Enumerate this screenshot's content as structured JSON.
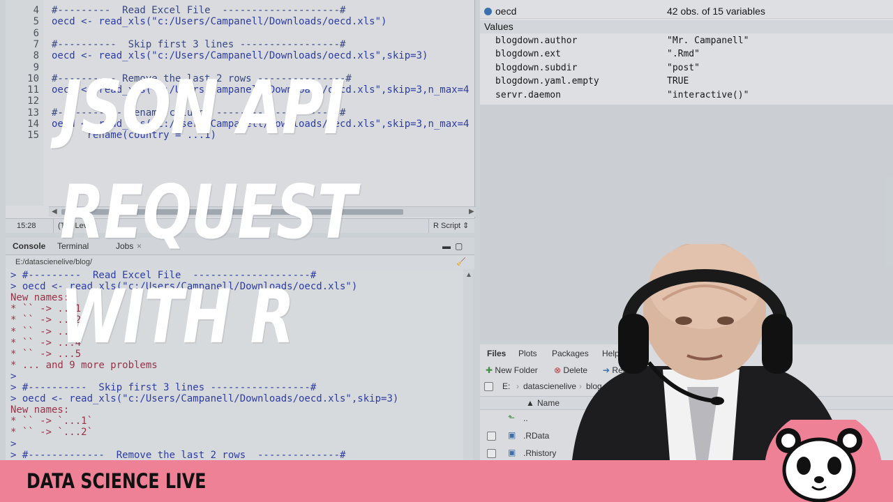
{
  "editor": {
    "lines": [
      {
        "n": "4",
        "text": "#---------  Read Excel File  --------------------#"
      },
      {
        "n": "5",
        "text": "oecd <- read_xls(\"c:/Users/Campanell/Downloads/oecd.xls\")"
      },
      {
        "n": "6",
        "text": ""
      },
      {
        "n": "7",
        "text": "#----------  Skip first 3 lines -----------------#"
      },
      {
        "n": "8",
        "text": "oecd <- read_xls(\"c:/Users/Campanell/Downloads/oecd.xls\",skip=3)"
      },
      {
        "n": "9",
        "text": ""
      },
      {
        "n": "10",
        "text": "#---------- Remove the last 2 rows ---------------#"
      },
      {
        "n": "11",
        "text": "oecd <- read_xls(\"c:/Users/Campanell/Downloads/oecd.xls\",skip=3,n_max=4"
      },
      {
        "n": "12",
        "text": ""
      },
      {
        "n": "13",
        "text": "#----------- Rename column  ---------------------#"
      },
      {
        "n": "14",
        "text": "oecd <- read_xls(\"c:/Users/Campanell/Downloads/oecd.xls\",skip=3,n_max=4"
      },
      {
        "n": "15",
        "text": "      rename(country = ...1)"
      }
    ],
    "cursor": "15:28",
    "scope": "(Top Level)",
    "filetype": "R Script"
  },
  "console": {
    "tabs": [
      "Console",
      "Terminal",
      "Jobs"
    ],
    "path": "E:/datascienelive/blog/",
    "lines": [
      {
        "kind": "cmd",
        "text": "> #---------  Read Excel File  --------------------#"
      },
      {
        "kind": "cmd",
        "text": "> oecd <- read_xls(\"c:/Users/Campanell/Downloads/oecd.xls\")"
      },
      {
        "kind": "warn",
        "text": "New names:"
      },
      {
        "kind": "warn",
        "text": "* `` -> ...1"
      },
      {
        "kind": "warn",
        "text": "* `` -> ...2"
      },
      {
        "kind": "warn",
        "text": "* `` -> ...3"
      },
      {
        "kind": "warn",
        "text": "* `` -> ...4"
      },
      {
        "kind": "warn",
        "text": "* `` -> ...5"
      },
      {
        "kind": "warn",
        "text": "* ... and 9 more problems"
      },
      {
        "kind": "cmd",
        "text": ">"
      },
      {
        "kind": "cmd",
        "text": "> #----------  Skip first 3 lines -----------------#"
      },
      {
        "kind": "cmd",
        "text": "> oecd <- read_xls(\"c:/Users/Campanell/Downloads/oecd.xls\",skip=3)"
      },
      {
        "kind": "warn",
        "text": "New names:"
      },
      {
        "kind": "warn",
        "text": "* `` -> `...1`"
      },
      {
        "kind": "warn",
        "text": "* `` -> `...2`"
      },
      {
        "kind": "cmd",
        "text": ">"
      },
      {
        "kind": "cmd",
        "text": "> #-------------  Remove the last 2 rows  --------------#"
      }
    ]
  },
  "environment": {
    "data_row": {
      "name": "oecd",
      "value": "42 obs. of 15 variables"
    },
    "values_header": "Values",
    "values": [
      {
        "name": "blogdown.author",
        "value": "\"Mr. Campanell\""
      },
      {
        "name": "blogdown.ext",
        "value": "\".Rmd\""
      },
      {
        "name": "blogdown.subdir",
        "value": "\"post\""
      },
      {
        "name": "blogdown.yaml.empty",
        "value": "TRUE"
      },
      {
        "name": "servr.daemon",
        "value": "\"interactive()\""
      }
    ]
  },
  "files": {
    "tabs": [
      "Files",
      "Plots",
      "Packages",
      "Help"
    ],
    "toolbar": {
      "new_folder": "New Folder",
      "delete": "Delete",
      "rename": "Rename"
    },
    "breadcrumb": [
      "E:",
      "datascienelive",
      "blog"
    ],
    "column_name": "Name",
    "rows": [
      "..",
      ".RData",
      ".Rhistory"
    ]
  },
  "overlay": {
    "title_lines": [
      "JSON API",
      "REQUEST",
      "WITH R"
    ]
  },
  "banner": {
    "text": "DATA SCIENCE LIVE",
    "color": "#ee8196"
  }
}
